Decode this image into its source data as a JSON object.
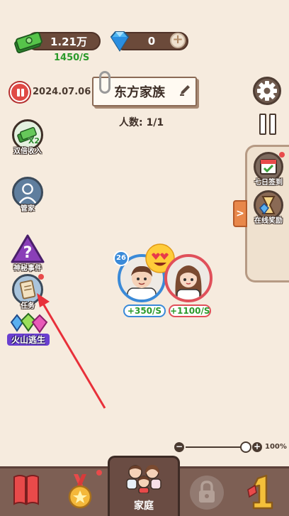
{
  "currency": {
    "money": "1.21万",
    "money_rate": "1450/S",
    "gems": "0",
    "plus": "+"
  },
  "date": "2024.07.06",
  "family": {
    "name": "东方家族",
    "members": "人数: 1/1"
  },
  "left_buttons": [
    {
      "label": "双倍收入",
      "badge": "X2"
    },
    {
      "label": "管家"
    },
    {
      "label": "神秘事件",
      "symbol": "?"
    },
    {
      "label": "任务"
    },
    {
      "label": "火山逃生"
    }
  ],
  "right_drawer": {
    "items": [
      {
        "label": "七日签到"
      },
      {
        "label": "在线奖励"
      }
    ],
    "toggle": ">"
  },
  "characters": [
    {
      "level": "26",
      "rate": "+350/S",
      "ring_color": "#3a8ad8"
    },
    {
      "rate": "+1100/S",
      "ring_color": "#e0505a"
    }
  ],
  "zoom": {
    "minus": "−",
    "plus": "+",
    "value": "100%",
    "level": 1.0
  },
  "bottom_nav": {
    "home_label": "家庭"
  },
  "colors": {
    "background": "#f6ebde",
    "rate_green": "#2a9a2a",
    "nav_bg": "#7d5f54"
  }
}
